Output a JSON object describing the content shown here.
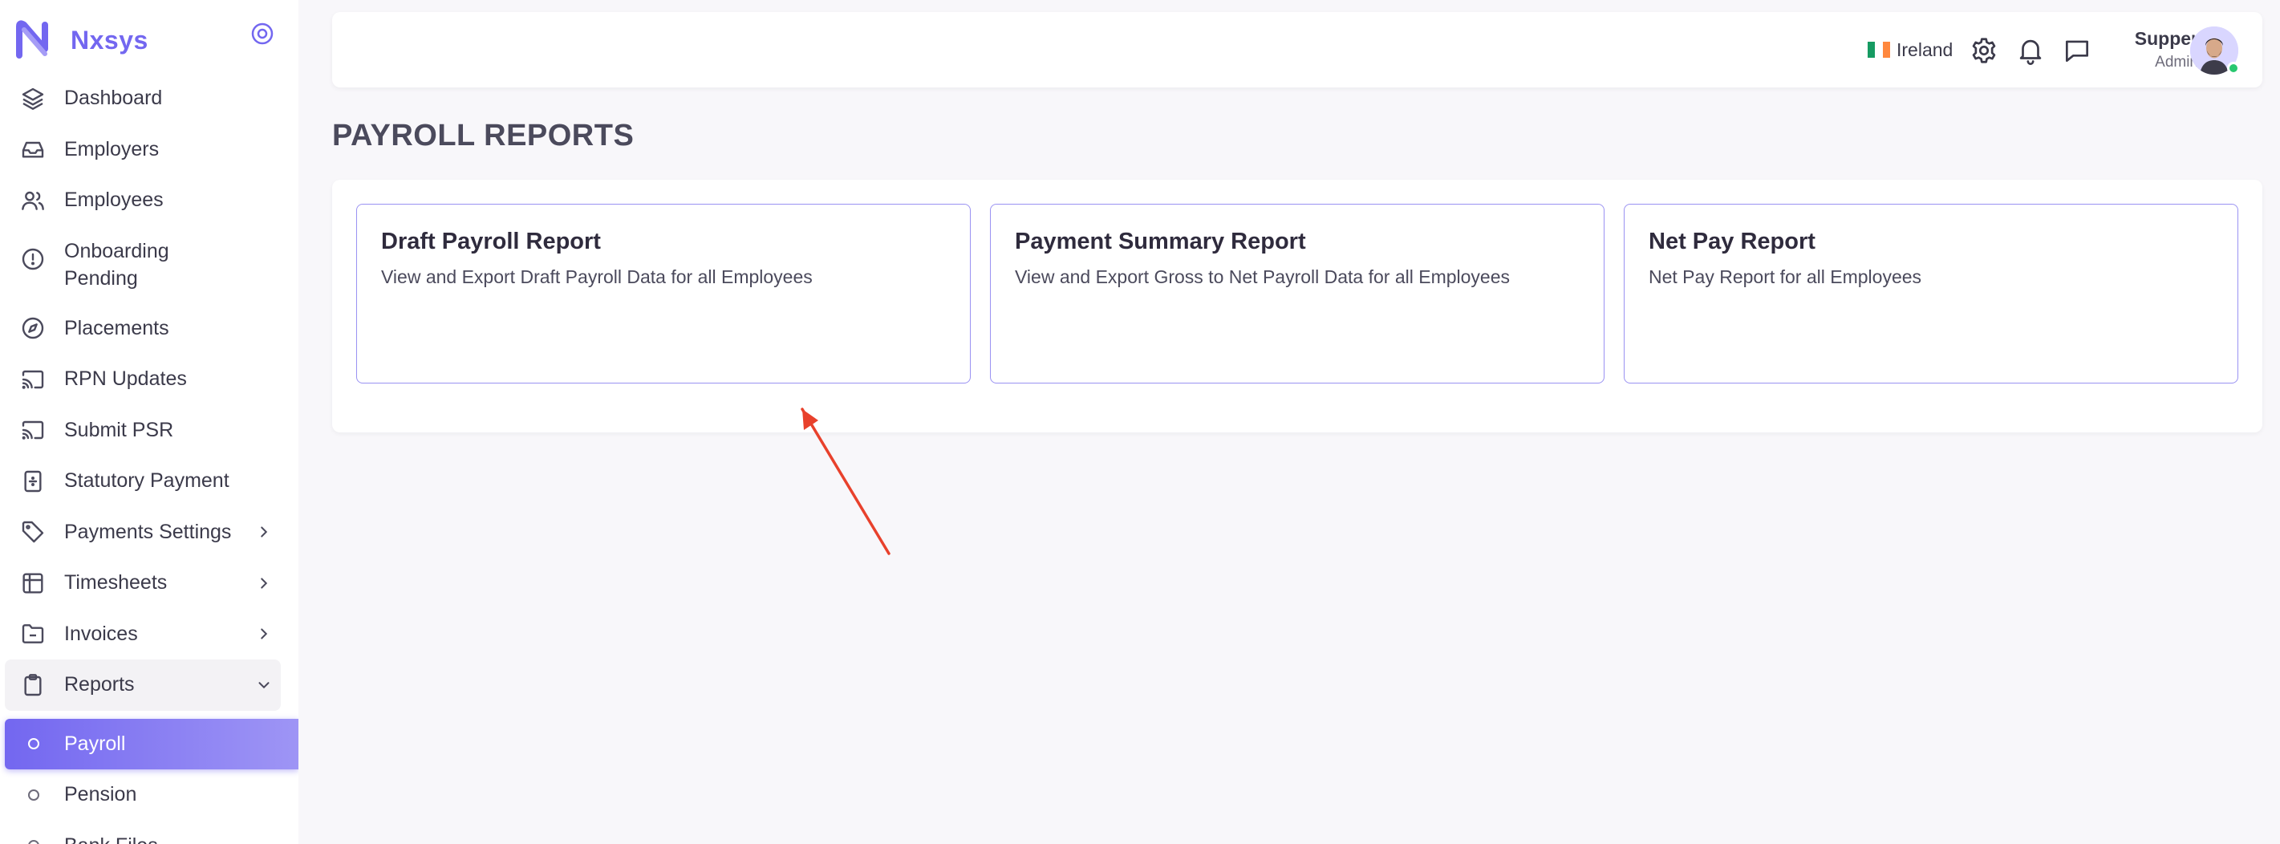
{
  "brand": {
    "name": "Nxsys"
  },
  "sidebar": {
    "items": [
      {
        "label": "Dashboard",
        "icon": "layers-icon"
      },
      {
        "label": "Employers",
        "icon": "inbox-icon"
      },
      {
        "label": "Employees",
        "icon": "users-icon"
      },
      {
        "label": "Onboarding Pending",
        "icon": "alert-circle-icon"
      },
      {
        "label": "Placements",
        "icon": "compass-icon"
      },
      {
        "label": "RPN Updates",
        "icon": "cast-icon"
      },
      {
        "label": "Submit PSR",
        "icon": "cast-icon"
      },
      {
        "label": "Statutory Payment",
        "icon": "calculator-icon"
      },
      {
        "label": "Payments Settings",
        "icon": "tag-icon"
      },
      {
        "label": "Timesheets",
        "icon": "table-icon"
      },
      {
        "label": "Invoices",
        "icon": "folder-minus-icon"
      },
      {
        "label": "Reports",
        "icon": "clipboard-icon"
      }
    ],
    "sub_items": [
      {
        "label": "Payroll"
      },
      {
        "label": "Pension"
      },
      {
        "label": "Bank Files"
      }
    ]
  },
  "header": {
    "country": "Ireland",
    "user_name": "Supper",
    "user_role": "Admin"
  },
  "page": {
    "title": "PAYROLL REPORTS"
  },
  "cards": [
    {
      "title": "Draft Payroll Report",
      "description": "View and Export Draft Payroll Data for all Employees"
    },
    {
      "title": "Payment Summary Report",
      "description": "View and Export Gross to Net Payroll Data for all Employees"
    },
    {
      "title": "Net Pay Report",
      "description": "Net Pay Report for all Employees"
    }
  ],
  "colors": {
    "accent": "#7367f0",
    "annotation_arrow": "#e8412c",
    "online": "#28c76f"
  }
}
